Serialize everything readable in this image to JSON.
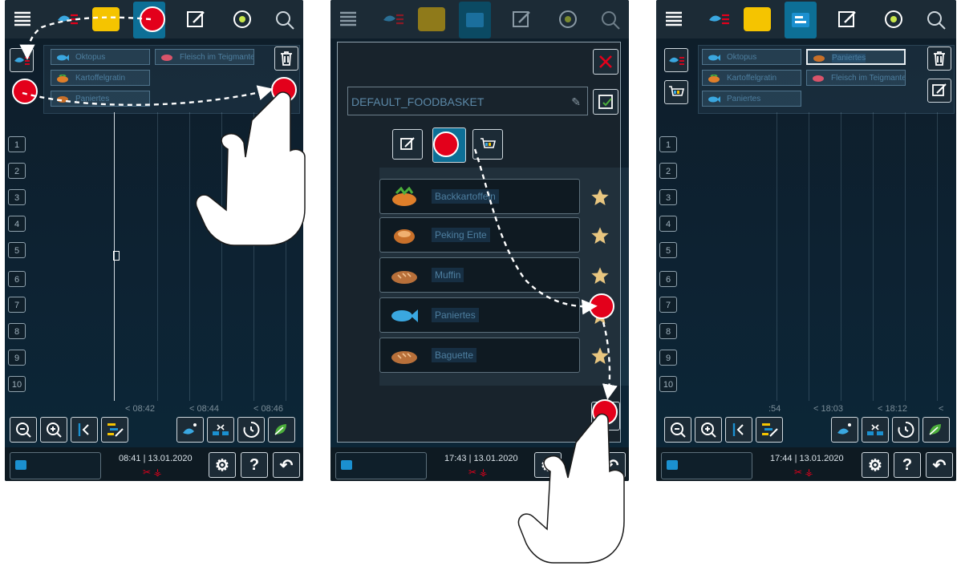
{
  "screen1": {
    "chips": [
      "Oktopus",
      "Fleisch im Teigmantel",
      "Kartoffelgratin",
      "Paniertes"
    ],
    "rack_levels": [
      "1",
      "2",
      "3",
      "4",
      "5",
      "6",
      "7",
      "8",
      "9",
      "10"
    ],
    "time_labels": [
      "< 08:42",
      "< 08:44",
      "< 08:46"
    ],
    "clock_time": "08:41",
    "clock_date": "13.01.2020"
  },
  "screen2": {
    "basket_name": "DEFAULT_FOODBASKET",
    "items": [
      {
        "label": "Backkartoffeln",
        "icon": "vegetable-icon"
      },
      {
        "label": "Peking Ente",
        "icon": "duck-icon"
      },
      {
        "label": "Muffin",
        "icon": "bread-icon"
      },
      {
        "label": "Paniertes",
        "icon": "fish-icon"
      },
      {
        "label": "Baguette",
        "icon": "bread-icon"
      }
    ],
    "clock_time": "17:43",
    "clock_date": "13.01.2020"
  },
  "screen3": {
    "chips": [
      "Oktopus",
      "Paniertes",
      "Kartoffelgratin",
      "Fleisch im Teigmantel",
      "Paniertes"
    ],
    "rack_levels": [
      "1",
      "2",
      "3",
      "4",
      "5",
      "6",
      "7",
      "8",
      "9",
      "10"
    ],
    "time_labels": [
      ":54",
      "< 18:03",
      "< 18:12",
      "<"
    ],
    "clock_time": "17:44",
    "clock_date": "13.01.2020"
  },
  "common": {
    "help_label": "?",
    "tab_icons": [
      "menu-icon",
      "cooking-paths-icon",
      "bread-basket-icon",
      "ipm-planner-icon",
      "edit-program-icon",
      "cooking-app-icon",
      "search-icon"
    ],
    "accent_color": "#0d6f96",
    "marker_color": "#e3001b",
    "highlight_color": "#f5c400"
  }
}
